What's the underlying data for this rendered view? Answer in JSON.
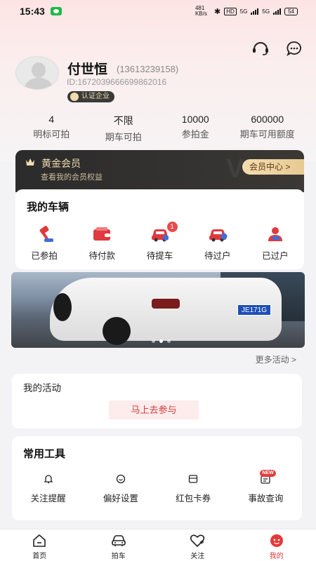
{
  "status_bar": {
    "time": "15:43",
    "net_speed": "481 KB/s",
    "hd_label": "HD",
    "sim1": "5G",
    "sim2": "5G",
    "battery": "54"
  },
  "profile": {
    "name": "付世恒",
    "phone": "(13613239158)",
    "id": "ID:1672039666699862016",
    "cert_label": "认证企业"
  },
  "stats": [
    {
      "value": "4",
      "label": "明标可拍"
    },
    {
      "value": "不限",
      "label": "期车可拍"
    },
    {
      "value": "10000",
      "label": "参拍金"
    },
    {
      "value": "600000",
      "label": "期车可用额度"
    }
  ],
  "vip": {
    "title": "黄金会员",
    "subtitle": "查看我的会员权益",
    "button": "会员中心 >"
  },
  "vehicles": {
    "title": "我的车辆",
    "items": [
      {
        "label": "已参拍",
        "icon": "gavel-icon"
      },
      {
        "label": "待付款",
        "icon": "wallet-icon"
      },
      {
        "label": "待提车",
        "icon": "car-pickup-icon",
        "badge": "1"
      },
      {
        "label": "待过户",
        "icon": "car-transfer-icon"
      },
      {
        "label": "已过户",
        "icon": "person-icon"
      }
    ]
  },
  "banner": {
    "plate": "JE171G",
    "more_link": "更多活动 >"
  },
  "activities": {
    "title": "我的活动",
    "join_button": "马上去参与"
  },
  "tools": {
    "title": "常用工具",
    "items": [
      {
        "label": "关注提醒",
        "icon": "bell-icon"
      },
      {
        "label": "偏好设置",
        "icon": "preference-icon"
      },
      {
        "label": "红包卡券",
        "icon": "coupon-icon"
      },
      {
        "label": "事故查询",
        "icon": "accident-query-icon",
        "badge": "NEW"
      }
    ]
  },
  "tabbar": [
    {
      "label": "首页",
      "icon": "home-icon"
    },
    {
      "label": "拍车",
      "icon": "car-icon"
    },
    {
      "label": "关注",
      "icon": "heart-icon"
    },
    {
      "label": "我的",
      "icon": "profile-icon",
      "active": true
    }
  ],
  "colors": {
    "accent": "#e33b3b",
    "vip_gold": "#f2dcb0",
    "vip_dark": "#2b2b2b"
  }
}
